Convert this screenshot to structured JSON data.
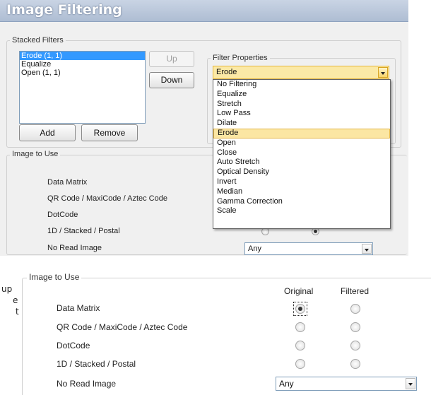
{
  "top": {
    "title": "Image Filtering",
    "stacked_filters": {
      "group_label": "Stacked Filters",
      "items": [
        "Erode (1, 1)",
        "Equalize",
        "Open (1, 1)"
      ],
      "up_label": "Up",
      "down_label": "Down",
      "add_label": "Add",
      "remove_label": "Remove"
    },
    "filter_properties": {
      "group_label": "Filter Properties",
      "selected": "Erode",
      "options": [
        "No Filtering",
        "Equalize",
        "Stretch",
        "Low Pass",
        "Dilate",
        "Erode",
        "Open",
        "Close",
        "Auto Stretch",
        "Optical Density",
        "Invert",
        "Median",
        "Gamma Correction",
        "Scale"
      ]
    },
    "image_to_use": {
      "group_label": "Image to Use",
      "rows": [
        "Data Matrix",
        "QR Code / MaxiCode / Aztec Code",
        "DotCode",
        "1D / Stacked / Postal",
        "No Read Image"
      ],
      "no_read_value": "Any"
    }
  },
  "side_text": [
    "up",
    "e",
    "t"
  ],
  "bottom": {
    "group_label": "Image to Use",
    "col_original": "Original",
    "col_filtered": "Filtered",
    "rows": [
      {
        "label": "Data Matrix",
        "original": true,
        "filtered": false
      },
      {
        "label": "QR Code / MaxiCode / Aztec Code",
        "original": false,
        "filtered": false
      },
      {
        "label": "DotCode",
        "original": false,
        "filtered": false
      },
      {
        "label": "1D / Stacked / Postal",
        "original": false,
        "filtered": false
      }
    ],
    "no_read_label": "No Read Image",
    "no_read_value": "Any"
  }
}
